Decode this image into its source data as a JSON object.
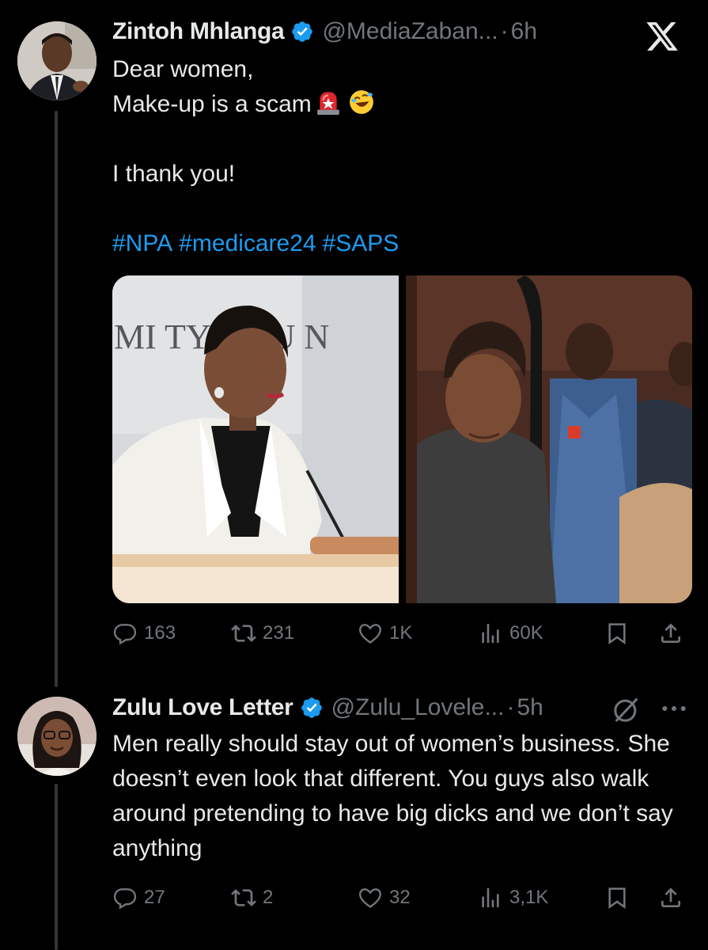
{
  "tweet": {
    "author_name": "Zintoh Mhlanga",
    "handle": "@MediaZaban...",
    "separator": "·",
    "time": "6h",
    "lines": [
      "Dear women,",
      "Make-up is a scam",
      "I thank you!"
    ],
    "hashtags": [
      "#NPA",
      "#medicare24",
      "#SAPS"
    ],
    "stats": {
      "replies": "163",
      "reposts": "231",
      "likes": "1K",
      "views": "60K"
    },
    "media_background_text": "MI     TY. RRU    N"
  },
  "reply": {
    "author_name": "Zulu Love Letter",
    "handle": "@Zulu_Lovele...",
    "separator": "·",
    "time": "5h",
    "text": "Men really should stay out of women’s business. She doesn’t even look that different. You guys also walk around pretending to have big dicks and we don’t say anything",
    "stats": {
      "replies": "27",
      "reposts": "2",
      "likes": "32",
      "views": "3,1K"
    }
  },
  "colors": {
    "background": "#000000",
    "text": "#e7e9ea",
    "muted": "#71767b",
    "link": "#1d9bf0",
    "verified": "#1d9bf0"
  },
  "icons": [
    "x-logo-icon",
    "verified-icon",
    "siren-emoji-icon",
    "rofl-emoji-icon",
    "reply-icon",
    "repost-icon",
    "like-icon",
    "views-icon",
    "bookmark-icon",
    "share-icon",
    "grok-icon",
    "more-icon"
  ]
}
